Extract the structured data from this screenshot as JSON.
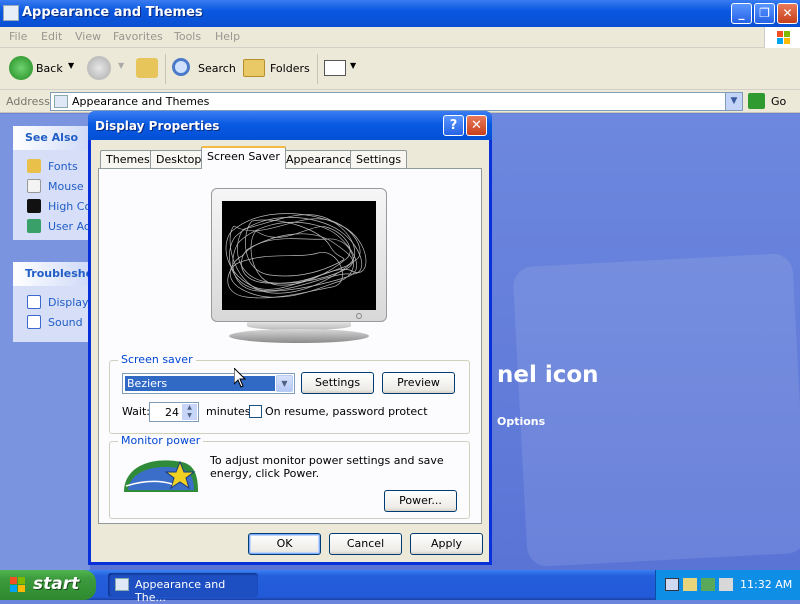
{
  "explorer": {
    "title": "Appearance and Themes",
    "menu": [
      "File",
      "Edit",
      "View",
      "Favorites",
      "Tools",
      "Help"
    ],
    "toolbar": {
      "back": "Back",
      "search": "Search",
      "folders": "Folders"
    },
    "address": {
      "label": "Address",
      "value": "Appearance and Themes",
      "go": "Go"
    },
    "see_also": {
      "title": "See Also",
      "items": [
        "Fonts",
        "Mouse P",
        "High Con",
        "User Acc"
      ]
    },
    "troubleshooters": {
      "title": "Troubleshoo",
      "items": [
        "Display",
        "Sound"
      ]
    },
    "main_heading_fragment": "nel icon",
    "options_fragment": "Options"
  },
  "dialog": {
    "title": "Display Properties",
    "tabs": [
      "Themes",
      "Desktop",
      "Screen Saver",
      "Appearance",
      "Settings"
    ],
    "active_tab": "Screen Saver",
    "screen_saver": {
      "group_label": "Screen saver",
      "selected": "Beziers",
      "settings_button": "Settings",
      "preview_button": "Preview",
      "wait_label": "Wait:",
      "wait_value": "24",
      "minutes_label": "minutes",
      "password_label": "On resume, password protect",
      "password_checked": false
    },
    "monitor_power": {
      "group_label": "Monitor power",
      "text": "To adjust monitor power settings and save energy, click Power.",
      "power_button": "Power..."
    },
    "buttons": {
      "ok": "OK",
      "cancel": "Cancel",
      "apply": "Apply"
    }
  },
  "taskbar": {
    "start": "start",
    "task_item": "Appearance and The...",
    "clock": "11:32 AM"
  },
  "colors": {
    "title_blue": "#0a58e0",
    "taskbar_blue": "#245edb",
    "start_green": "#3c9a3c",
    "tab_highlight": "#f5b840",
    "selection": "#316ac5"
  }
}
